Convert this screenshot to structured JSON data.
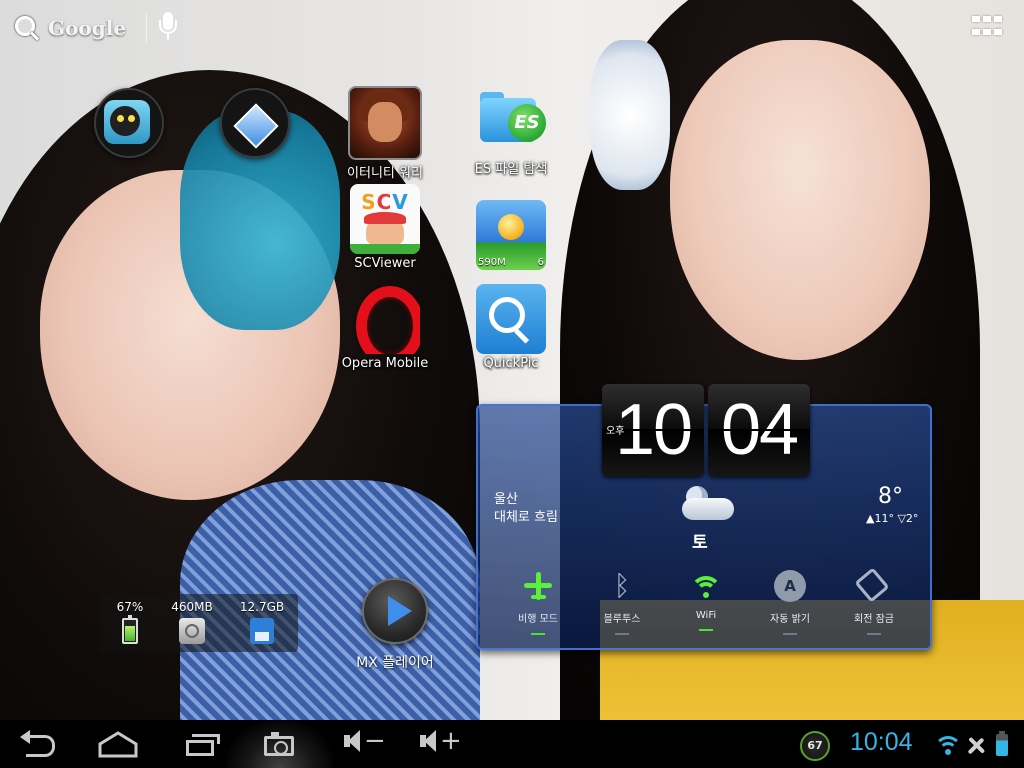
{
  "topbar": {
    "search_label": "Google",
    "search_icon": "search-icon",
    "voice_icon": "mic-icon",
    "apps_icon": "apps-grid-icon"
  },
  "apps": [
    {
      "label": "이터니티 워리",
      "icon": "infinity-warrior-icon"
    },
    {
      "label": "ES 파일 탐색",
      "icon": "es-file-explorer-icon"
    },
    {
      "label": "SCViewer",
      "icon": "scviewer-icon"
    },
    {
      "label": "Opera Mobile",
      "icon": "opera-icon"
    },
    {
      "label": "QuickPic",
      "icon": "quickpic-icon"
    }
  ],
  "storage_tile": {
    "size": "590M",
    "count": "6"
  },
  "mx_player": {
    "label": "MX 플레이어"
  },
  "system_status": {
    "battery": "67%",
    "battery_level": 0.67,
    "ram": "460MB",
    "sd": "12.7GB"
  },
  "clock_widget": {
    "hour": "10",
    "minute": "04",
    "ampm": "오후",
    "city": "울산",
    "condition": "대체로 흐림",
    "weekday": "토",
    "temperature": "8°",
    "high_low": "▲11° ▽2°",
    "toggles": [
      {
        "label": "비행 모드",
        "on": true
      },
      {
        "label": "블루투스",
        "on": false
      },
      {
        "label": "WiFi",
        "on": true
      },
      {
        "label": "자동 밝기",
        "on": false
      },
      {
        "label": "회전 잠금",
        "on": false
      }
    ]
  },
  "status_bar": {
    "battery_badge": "67",
    "time": "10:04"
  },
  "colors": {
    "accent_blue": "#33b5e5",
    "toggle_on": "#5bf03a",
    "widget_border": "#4678dc"
  }
}
